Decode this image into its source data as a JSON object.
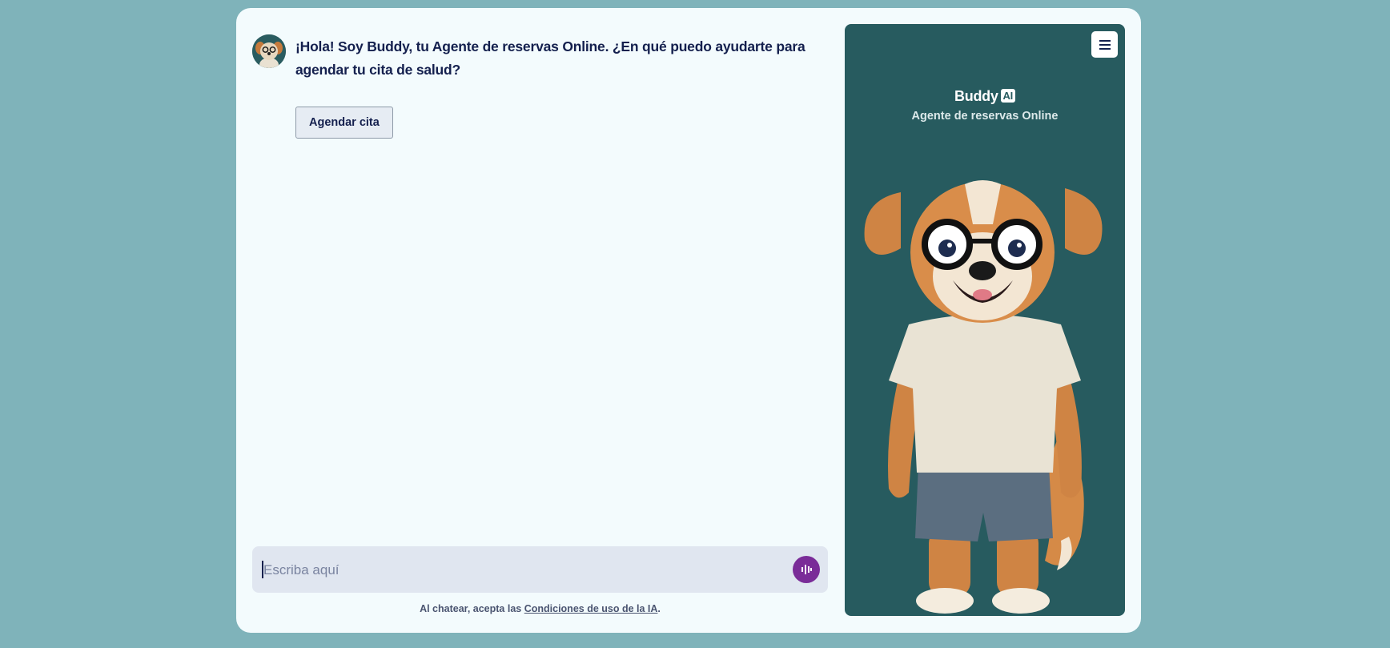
{
  "chat": {
    "greeting_part1": "¡Hola! Soy Buddy, tu ",
    "greeting_bold": "Agente de reservas Online",
    "greeting_part2": ". ¿En qué puedo ayudarte para agendar tu cita de salud?",
    "quick_reply_label": "Agendar cita"
  },
  "composer": {
    "placeholder": "Escriba aquí",
    "value": "",
    "voice_icon": "voice-wave-icon"
  },
  "legal": {
    "prefix": "Al chatear, acepta las ",
    "link_text": "Condiciones de uso de la IA",
    "suffix": "."
  },
  "panel": {
    "brand_name": "Buddy",
    "brand_badge": "AI",
    "subtitle": "Agente de reservas Online",
    "menu_icon": "hamburger-menu-icon"
  },
  "colors": {
    "page_bg": "#7fb3ba",
    "card_bg": "#f3fbfd",
    "panel_bg": "#275b5f",
    "text_primary": "#14204e",
    "voice_button": "#7a2c98",
    "composer_bg": "#e0e6f0"
  }
}
